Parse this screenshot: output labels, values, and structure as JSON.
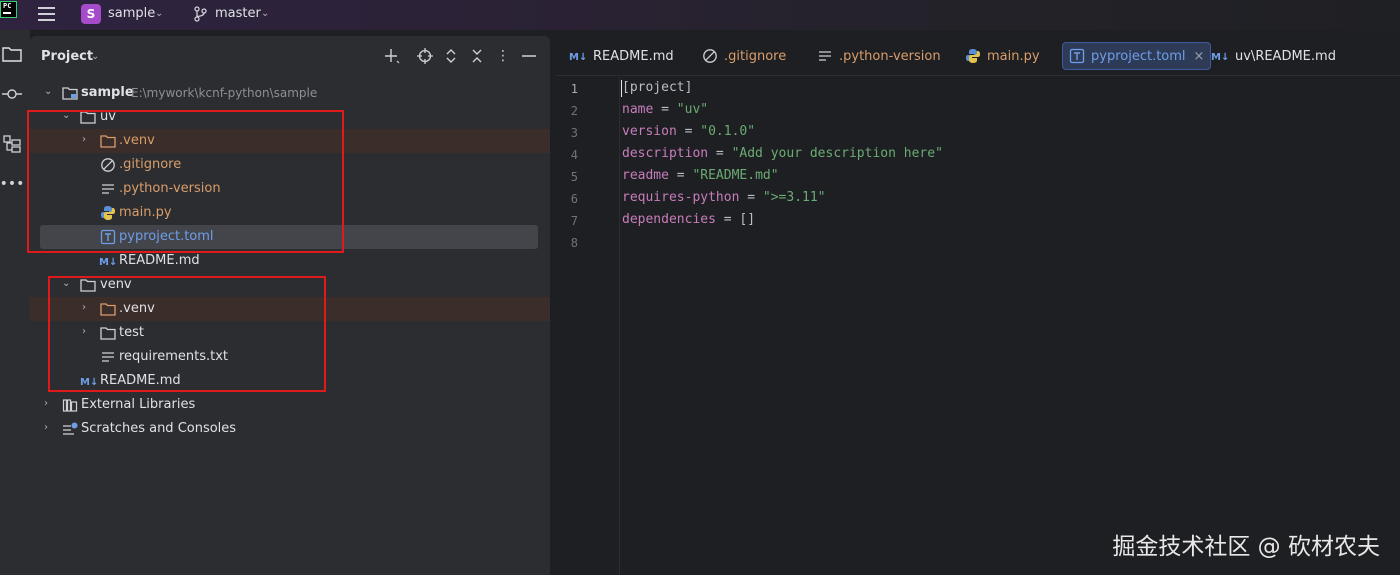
{
  "topbar": {
    "logo_text": "PC",
    "project_badge": "S",
    "project_name": "sample",
    "branch": "master"
  },
  "panel": {
    "title": "Project"
  },
  "tree": {
    "root": {
      "label": "sample",
      "path": "E:\\mywork\\kcnf-python\\sample"
    },
    "uv": {
      "label": "uv",
      "children": [
        ".venv",
        ".gitignore",
        ".python-version",
        "main.py",
        "pyproject.toml",
        "README.md"
      ]
    },
    "venv": {
      "label": "venv",
      "children": [
        ".venv",
        "test",
        "requirements.txt"
      ]
    },
    "root_readme": "README.md",
    "external_libraries": "External Libraries",
    "scratches": "Scratches and Consoles"
  },
  "tabs": [
    {
      "label": "README.md"
    },
    {
      "label": ".gitignore"
    },
    {
      "label": ".python-version"
    },
    {
      "label": "main.py"
    },
    {
      "label": "pyproject.toml"
    },
    {
      "label": "uv\\README.md"
    }
  ],
  "editor": {
    "line_numbers": [
      "1",
      "2",
      "3",
      "4",
      "5",
      "6",
      "7",
      "8"
    ],
    "lines": {
      "l1": "[project]",
      "l2_key": "name",
      "l2_val": "\"uv\"",
      "l3_key": "version",
      "l3_val": "\"0.1.0\"",
      "l4_key": "description",
      "l4_val": "\"Add your description here\"",
      "l5_key": "readme",
      "l5_val": "\"README.md\"",
      "l6_key": "requires-python",
      "l6_val": "\">=3.11\"",
      "l7_key": "dependencies",
      "l7_val": "[]",
      "eq": " = "
    }
  },
  "watermark": "掘金技术社区 @ 砍材农夫",
  "colors": {
    "accent_blue": "#3d5a9c",
    "excluded_orange": "#d99d6b",
    "annotation_red": "#e01a1a",
    "string_green": "#6aab73"
  }
}
